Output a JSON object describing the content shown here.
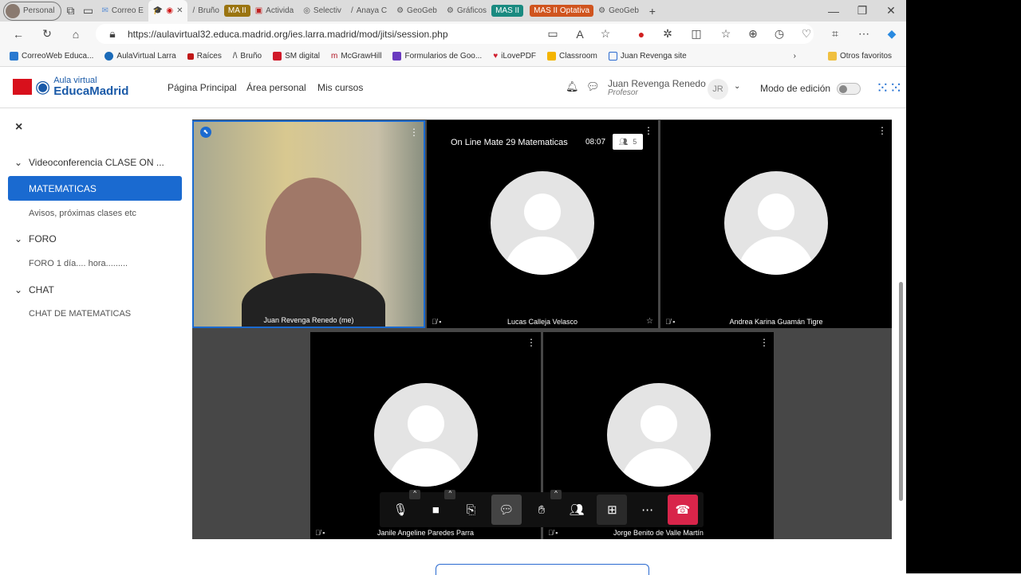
{
  "browser": {
    "profile": "Personal",
    "tabs": [
      "Correo E",
      "",
      "Bruño",
      "Activida",
      "Selectiv",
      "Anaya C",
      "GeoGeb",
      "Gráficos",
      "GeoGeb"
    ],
    "groups": [
      {
        "label": "MA II",
        "color": "#9a7410"
      },
      {
        "label": "MAS II",
        "color": "#1a8a80"
      },
      {
        "label": "MAS II Optativa",
        "color": "#d0541e"
      }
    ],
    "url": "https://aulavirtual32.educa.madrid.org/ies.larra.madrid/mod/jitsi/session.php",
    "bookmarks": [
      "CorreoWeb Educa...",
      "AulaVirtual Larra",
      "Raíces",
      "Bruño",
      "SM digital",
      "McGrawHill",
      "Formularios de Goo...",
      "iLovePDF",
      "Classroom",
      "Juan Revenga site"
    ],
    "other_favorites": "Otros favoritos"
  },
  "moodle": {
    "logo_top": "Aula virtual",
    "logo_bottom": "EducaMadrid",
    "nav": [
      "Página Principal",
      "Área personal",
      "Mis cursos"
    ],
    "user": "Juan Revenga Renedo",
    "role": "Profesor",
    "initials": "JR",
    "edit_mode": "Modo de edición"
  },
  "sidebar": {
    "close": "×",
    "items": [
      {
        "label": "Videoconferencia CLASE ON ...",
        "type": "section"
      },
      {
        "label": "MATEMATICAS",
        "type": "active"
      },
      {
        "label": "Avisos, próximas clases etc",
        "type": "item"
      },
      {
        "label": "FORO",
        "type": "section"
      },
      {
        "label": "FORO 1 día.... hora.........",
        "type": "item"
      },
      {
        "label": "CHAT",
        "type": "section"
      },
      {
        "label": "CHAT DE MATEMATICAS",
        "type": "item"
      }
    ]
  },
  "meeting": {
    "title": "On Line Mate 29 Matematicas",
    "time": "08:07",
    "participants": "5",
    "tiles": [
      "Juan Revenga Renedo (me)",
      "Lucas Calleja Velasco",
      "Andrea Karina Guamán Tigre",
      "Janile Angeline Paredes Parra",
      "Jorge Benito de Valle Martín"
    ]
  }
}
